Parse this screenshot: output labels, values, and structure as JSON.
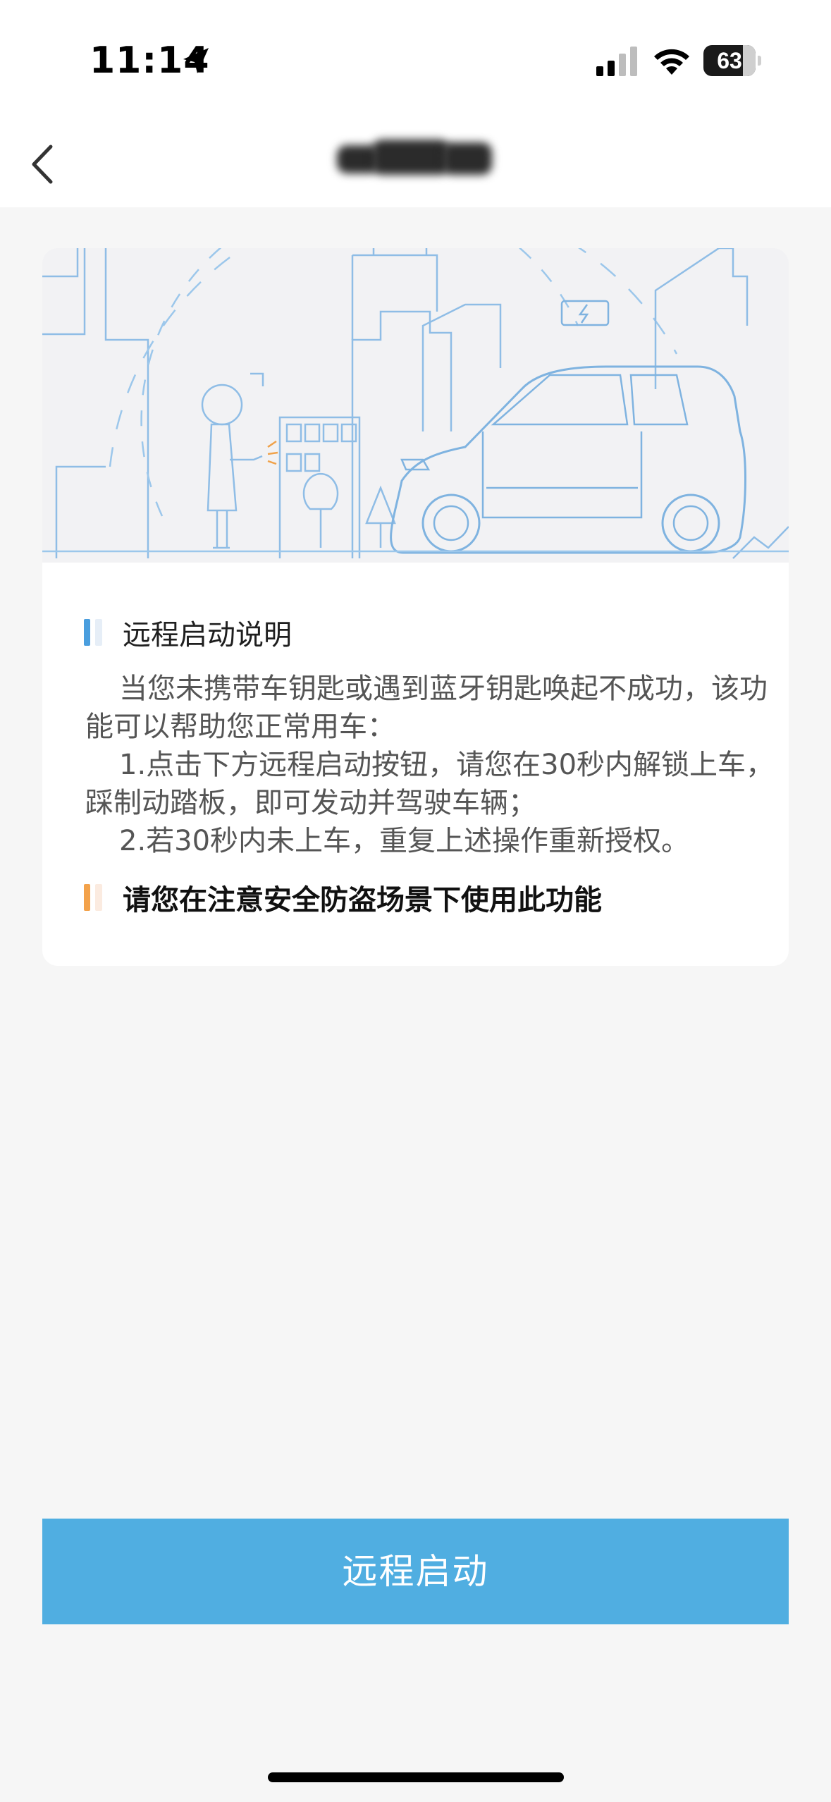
{
  "status_bar": {
    "time": "11:14",
    "battery_level": "63",
    "icons": [
      "location-arrow-icon",
      "cellular-signal-icon",
      "wifi-icon",
      "battery-icon"
    ]
  },
  "nav": {
    "back_icon": "chevron-left-icon"
  },
  "card": {
    "illustration_icons": [
      "city-skyline",
      "person-with-phone",
      "car",
      "battery-charging-icon",
      "tree"
    ],
    "section_title": "远程启动说明",
    "paragraphs": [
      "当您未携带车钥匙或遇到蓝牙钥匙唤起不成功，该功能可以帮助您正常用车：",
      "1.点击下方远程启动按钮，请您在30秒内解锁上车，踩制动踏板，即可发动并驾驶车辆；",
      "2.若30秒内未上车，重复上述操作重新授权。"
    ],
    "warning": "请您在注意安全防盗场景下使用此功能"
  },
  "actions": {
    "remote_start_label": "远程启动"
  },
  "colors": {
    "accent": "#50aee1",
    "section_bar": "#4a9ede",
    "warning_bar": "#f3a24b",
    "background": "#f6f6f6"
  }
}
